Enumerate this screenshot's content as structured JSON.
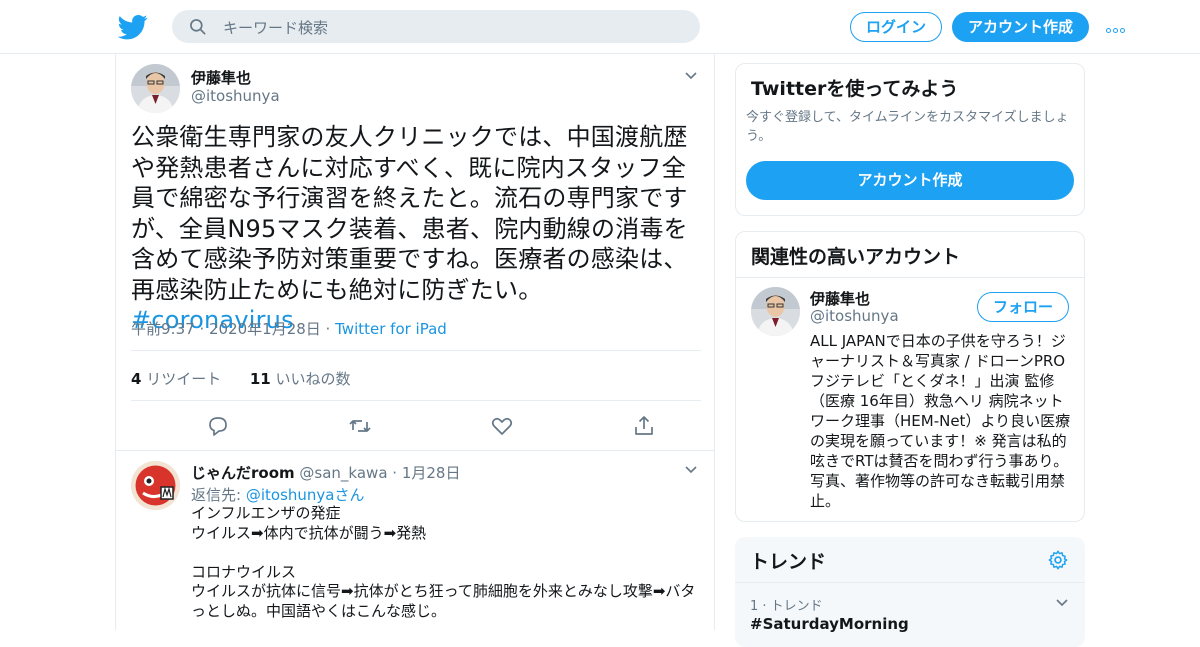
{
  "header": {
    "search_placeholder": "キーワード検索",
    "login_label": "ログイン",
    "signup_label": "アカウント作成"
  },
  "tweet": {
    "author_name": "伊藤隼也",
    "author_handle": "@itoshunya",
    "text": "公衆衛生専門家の友人クリニックでは、中国渡航歴や発熱患者さんに対応すべく、既に院内スタッフ全員で綿密な予行演習を終えたと。流石の専門家ですが、全員N95マスク装着、患者、院内動線の消毒を含めて感染予防対策重要ですね。医療者の感染は、再感染防止ためにも絶対に防ぎたい。",
    "hashtag": "#coronavirus",
    "timestamp": "午前9:37 · 2020年1月28日 ·",
    "source": "Twitter for iPad",
    "retweets_count": "4",
    "retweets_label": "リツイート",
    "likes_count": "11",
    "likes_label": "いいねの数"
  },
  "reply": {
    "author_name": "じゃんだroom",
    "author_handle": "@san_kawa",
    "date": "· 1月28日",
    "reply_to_label": "返信先:",
    "reply_to_handle": "@itoshunyaさん",
    "text": "インフルエンザの発症\nウイルス➡体内で抗体が闘う➡発熱\n\nコロナウイルス\nウイルスが抗体に信号➡抗体がとち狂って肺細胞を外来とみなし攻撃➡バタっとしぬ。中国語やくはこんな感じ。"
  },
  "signup_card": {
    "title": "Twitterを使ってみよう",
    "subtitle": "今すぐ登録して、タイムラインをカスタマイズしましょう。",
    "button_label": "アカウント作成"
  },
  "related_card": {
    "title": "関連性の高いアカウント",
    "account_name": "伊藤隼也",
    "account_handle": "@itoshunya",
    "follow_label": "フォロー",
    "bio": "ALL JAPANで日本の子供を守ろう！ジャーナリスト＆写真家 / ドローンPRO フジテレビ「とくダネ！」出演 監修（医療 16年目）救急ヘリ 病院ネットワーク理事（HEM-Net）より良い医療の実現を願っています！※ 発言は私的呟きでRTは賛否を問わず行う事あり。写真、著作物等の許可なき転載引用禁止。"
  },
  "trends_card": {
    "title": "トレンド",
    "trend_meta": "1 · トレンド",
    "trend_tag": "#SaturdayMorning"
  },
  "colors": {
    "brand": "#1da1f2",
    "link": "#1b95e0",
    "muted": "#657786",
    "border": "#e6ecf0"
  }
}
